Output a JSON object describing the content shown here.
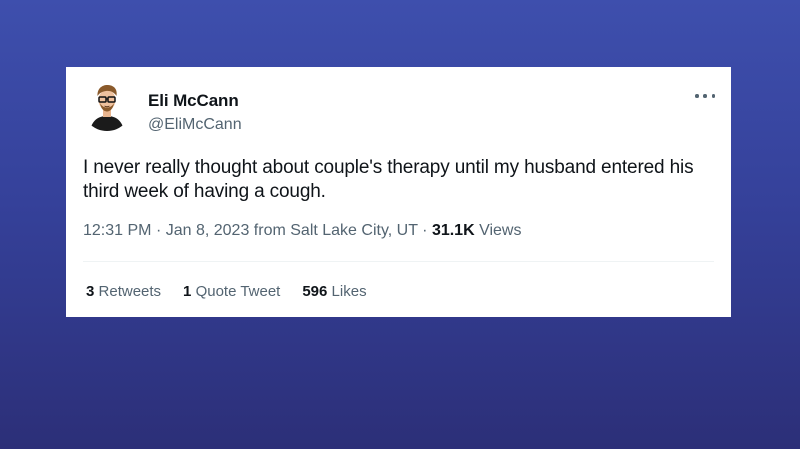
{
  "tweet": {
    "display_name": "Eli McCann",
    "handle": "@EliMcCann",
    "text": "I never really thought about couple's therapy until my husband entered his third week of having a cough.",
    "time": "12:31 PM",
    "date": "Jan 8, 2023",
    "location": "from Salt Lake City, UT",
    "views_count": "31.1K",
    "views_label": "Views",
    "separator": "·"
  },
  "stats": {
    "retweets_count": "3",
    "retweets_label": "Retweets",
    "quotes_count": "1",
    "quotes_label": "Quote Tweet",
    "likes_count": "596",
    "likes_label": "Likes"
  },
  "icons": {
    "more": "more-icon",
    "avatar": "avatar"
  },
  "colors": {
    "background_top": "#3e4fad",
    "background_bottom": "#2c2f78",
    "card": "#ffffff",
    "text_primary": "#0f1419",
    "text_secondary": "#536471"
  }
}
